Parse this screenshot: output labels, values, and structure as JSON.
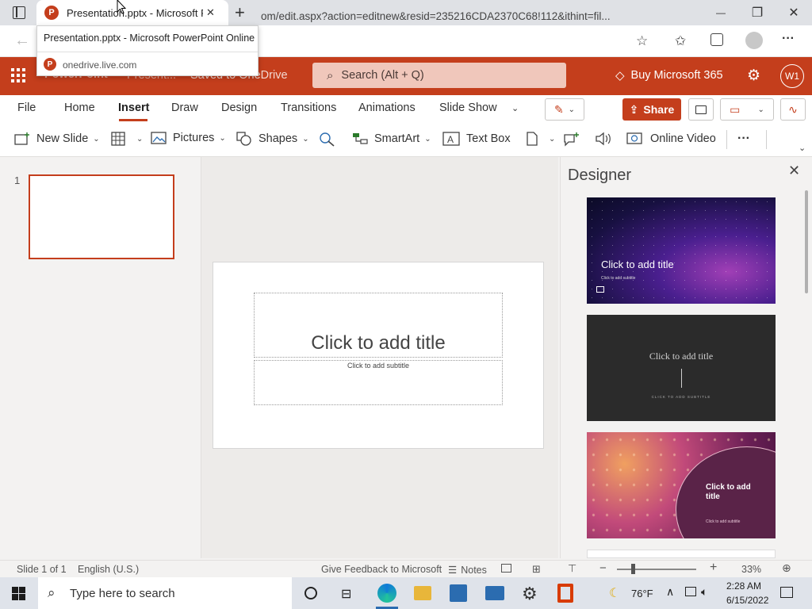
{
  "browser": {
    "tab_title": "Presentation.pptx - Microsoft Po",
    "new_tab": "+",
    "url": "om/edit.aspx?action=editnew&resid=235216CDA2370C68!112&ithint=fil...",
    "hover_title": "Presentation.pptx - Microsoft PowerPoint Online",
    "hover_domain": "onedrive.live.com",
    "minimize": "—",
    "restore": "❐",
    "close": "✕",
    "more": "···"
  },
  "app": {
    "name": "PowerPoint",
    "doc_name": "Present...",
    "save_status": "Saved to OneDrive",
    "search_placeholder": "Search (Alt + Q)",
    "buy_label": "Buy Microsoft 365",
    "avatar_initials": "W1"
  },
  "ribbon_tabs": [
    "File",
    "Home",
    "Insert",
    "Draw",
    "Design",
    "Transitions",
    "Animations",
    "Slide Show"
  ],
  "active_tab": "Insert",
  "ribbon": {
    "new_slide": "New Slide",
    "pictures": "Pictures",
    "shapes": "Shapes",
    "smartart": "SmartArt",
    "text_box": "Text Box",
    "online_video": "Online Video",
    "share": "Share",
    "more": "···"
  },
  "thumbnails": {
    "number": "1"
  },
  "slide": {
    "title_placeholder": "Click to add title",
    "subtitle_placeholder": "Click to add subtitle"
  },
  "designer": {
    "title": "Designer",
    "close": "✕",
    "card1_title": "Click to add title",
    "card1_sub": "Click to add subtitle",
    "card2_title": "Click to add title",
    "card2_sub": "CLICK TO ADD SUBTITLE",
    "card3_title": "Click to add title",
    "card3_sub": "Click to add subtitle"
  },
  "status": {
    "slide_of": "Slide 1 of 1",
    "language": "English (U.S.)",
    "feedback": "Give Feedback to Microsoft",
    "notes": "Notes",
    "zoom": "33%",
    "zoom_level": 0.33
  },
  "taskbar": {
    "search_placeholder": "Type here to search",
    "weather": "76°F",
    "time": "2:28 AM",
    "date": "6/15/2022"
  },
  "colors": {
    "brand": "#c43e1c",
    "accent_share": "#c43e1c"
  }
}
